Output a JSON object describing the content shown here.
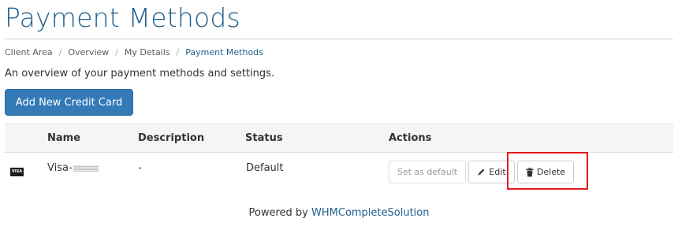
{
  "page": {
    "title": "Payment Methods",
    "breadcrumb": [
      {
        "label": "Client Area"
      },
      {
        "label": "Overview"
      },
      {
        "label": "My Details"
      },
      {
        "label": "Payment Methods"
      }
    ],
    "breadcrumb_separator": "/",
    "overview_text": "An overview of your payment methods and settings."
  },
  "actions": {
    "add_button_label": "Add New Credit Card"
  },
  "table": {
    "headers": [
      "Name",
      "Description",
      "Status",
      "Actions"
    ],
    "rows": [
      {
        "card_brand": "VISA",
        "name": "Visa-",
        "description": "-",
        "status": "Default",
        "buttons": {
          "set_default": "Set as default",
          "edit": "Edit",
          "delete": "Delete"
        }
      }
    ]
  },
  "footer": {
    "powered_by": "Powered by",
    "link_text": "WHMCompleteSolution"
  },
  "colors": {
    "title": "#1f5f8c",
    "primary_button": "#337ab7",
    "highlight_box": "#e3191f",
    "link": "#1f5f8c"
  },
  "icons": {
    "card": "visa-card-icon",
    "edit": "pencil-icon",
    "delete": "trash-icon"
  }
}
